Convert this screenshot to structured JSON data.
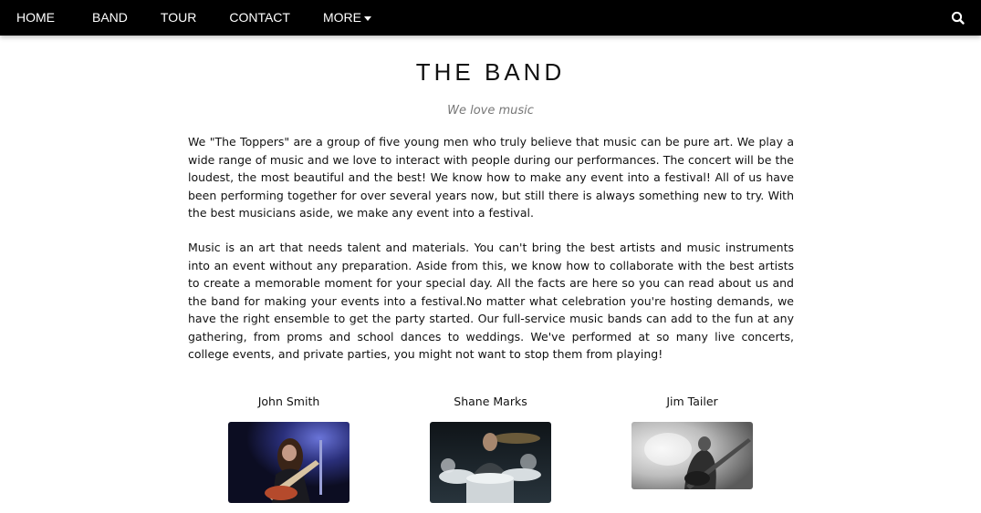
{
  "nav": {
    "items": [
      "HOME",
      "BAND",
      "TOUR",
      "CONTACT"
    ],
    "more_label": "MORE",
    "search_icon": "search-icon",
    "caret_icon": "caret-down-icon"
  },
  "band": {
    "title": "THE BAND",
    "tagline": "We love music",
    "paragraphs": [
      "We \"The Toppers\" are a group of five young men who truly believe that music can be pure art. We play a wide range of music and we love to interact with people during our performances. The concert will be the loudest, the most beautiful and the best! We know how to make any event into a festival! All of us have been performing together for over several years now, but still there is always something new to try. With the best musicians aside, we make any event into a festival.",
      "Music is an art that needs talent and materials. You can't bring the best artists and music instruments into an event without any preparation. Aside from this, we know how to collaborate with the best artists to create a memorable moment for your special day. All the facts are here so you can read about us and the band for making your events into a festival.No matter what celebration you're hosting demands, we have the right ensemble to get the party started. Our full-service music bands can add to the fun at any gathering, from proms and school dances to weddings. We've performed at so many live concerts, college events, and private parties, you might not want to stop them from playing!"
    ]
  },
  "members": [
    {
      "name": "John Smith"
    },
    {
      "name": "Shane Marks"
    },
    {
      "name": "Jim Tailer"
    }
  ],
  "colors": {
    "navbar_bg": "#000000",
    "nav_text": "#ffffff",
    "tagline": "#777777"
  }
}
